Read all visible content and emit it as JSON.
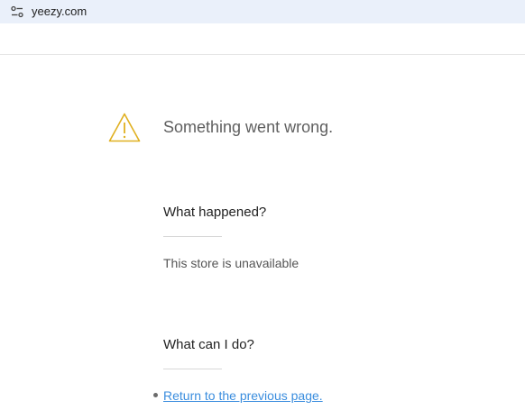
{
  "browser": {
    "url": "yeezy.com",
    "site_info_icon": "tune-icon"
  },
  "error": {
    "icon": "warning-icon",
    "icon_color": "#e0b020",
    "title": "Something went wrong."
  },
  "what_happened": {
    "heading": "What happened?",
    "text": "This store is unavailable"
  },
  "what_can_i_do": {
    "heading": "What can I do?",
    "link_text": "Return to the previous page.",
    "link_color": "#3a8dde"
  }
}
